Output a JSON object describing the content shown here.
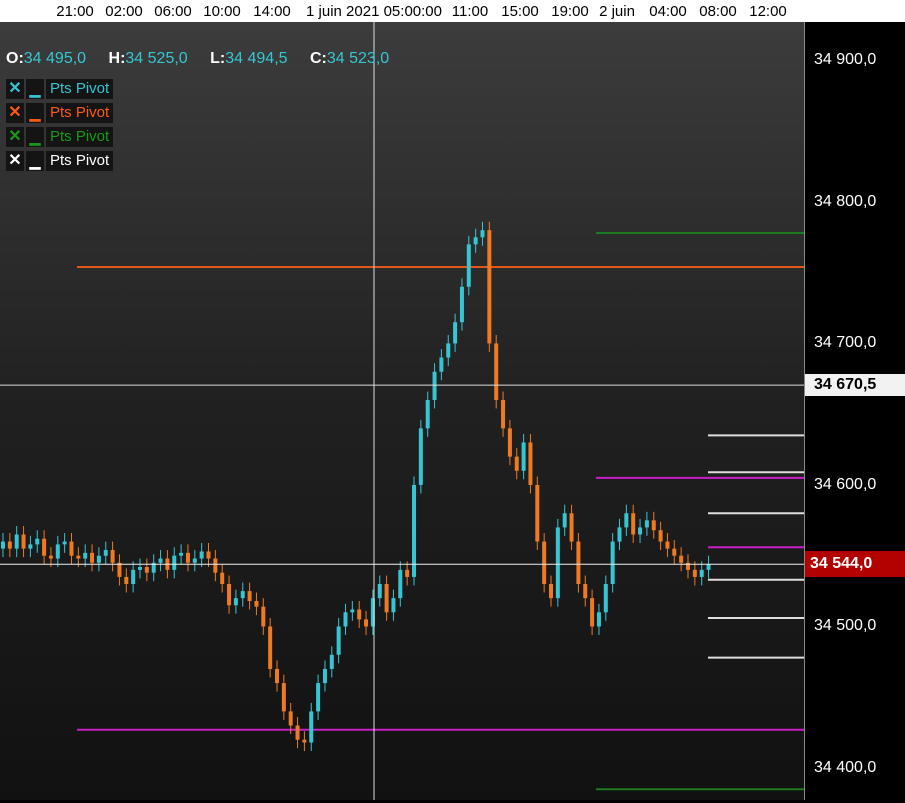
{
  "time_axis": {
    "labels": [
      "21:00",
      "02:00",
      "06:00",
      "10:00",
      "14:00",
      "1 juin 2021 05:00:00",
      "11:00",
      "15:00",
      "19:00",
      "2 juin",
      "04:00",
      "08:00",
      "12:00"
    ],
    "highlighted": "1 juin 2021 05:00:00"
  },
  "ohlc": {
    "o_label": "O:",
    "o_value": "34 495,0",
    "h_label": "H:",
    "h_value": "34 525,0",
    "l_label": "L:",
    "l_value": "34 494,5",
    "c_label": "C:",
    "c_value": "34 523,0"
  },
  "legend": [
    {
      "label": "Pts Pivot",
      "color": "#36c6d3",
      "x": "✕",
      "sym": "▁"
    },
    {
      "label": "Pts Pivot",
      "color": "#ff5a14",
      "x": "✕",
      "sym": "▁"
    },
    {
      "label": "Pts Pivot",
      "color": "#1a9a1a",
      "x": "✕",
      "sym": "▁"
    },
    {
      "label": "Pts Pivot",
      "color": "#ffffff",
      "x": "✕",
      "sym": "▁"
    }
  ],
  "price_axis": {
    "labels": [
      "34 900,0",
      "34 800,0",
      "34 700,0",
      "34 600,0",
      "34 500,0",
      "34 400,0"
    ],
    "cursor_label": "34 670,5",
    "last_label": "34 544,0"
  },
  "colors": {
    "up": "#36c6d3",
    "down": "#f07a22",
    "pivot_orange": "#e0561c",
    "pivot_magenta": "#c81ec8",
    "pivot_green": "#1e7a1e",
    "pivot_white": "#dddddd",
    "crosshair": "#dddddd",
    "last_price_bg": "#b30000"
  },
  "chart_data": {
    "type": "candlestick",
    "y_ticks": [
      34900,
      34800,
      34700,
      34600,
      34500,
      34400
    ],
    "crosshair_price": 34670.5,
    "last_price": 34544.0,
    "pivot_lines": [
      {
        "price": 34754,
        "color": "orange"
      },
      {
        "price": 34427,
        "color": "magenta"
      },
      {
        "price": 34605,
        "color": "magenta"
      },
      {
        "price": 34556,
        "color": "magenta"
      },
      {
        "price": 34778,
        "color": "green"
      },
      {
        "price": 34385,
        "color": "green"
      },
      {
        "price": 34635,
        "color": "white"
      },
      {
        "price": 34609,
        "color": "white"
      },
      {
        "price": 34580,
        "color": "white"
      },
      {
        "price": 34533,
        "color": "white"
      },
      {
        "price": 34506,
        "color": "white"
      },
      {
        "price": 34478,
        "color": "white"
      }
    ],
    "candles_close": [
      34560,
      34555,
      34565,
      34555,
      34558,
      34562,
      34550,
      34548,
      34558,
      34560,
      34550,
      34548,
      34552,
      34545,
      34550,
      34554,
      34545,
      34535,
      34530,
      34540,
      34542,
      34538,
      34545,
      34548,
      34540,
      34550,
      34552,
      34545,
      34548,
      34553,
      34548,
      34538,
      34530,
      34515,
      34520,
      34525,
      34518,
      34514,
      34500,
      34470,
      34460,
      34440,
      34430,
      34420,
      34418,
      34440,
      34460,
      34470,
      34480,
      34500,
      34510,
      34512,
      34505,
      34500,
      34520,
      34530,
      34510,
      34520,
      34540,
      34535,
      34600,
      34640,
      34660,
      34680,
      34690,
      34700,
      34715,
      34740,
      34770,
      34775,
      34780,
      34700,
      34660,
      34640,
      34620,
      34610,
      34630,
      34600,
      34560,
      34530,
      34520,
      34570,
      34580,
      34560,
      34530,
      34520,
      34500,
      34510,
      34530,
      34560,
      34570,
      34580,
      34565,
      34570,
      34575,
      34568,
      34560,
      34555,
      34550,
      34545,
      34540,
      34535,
      34540,
      34544
    ]
  }
}
